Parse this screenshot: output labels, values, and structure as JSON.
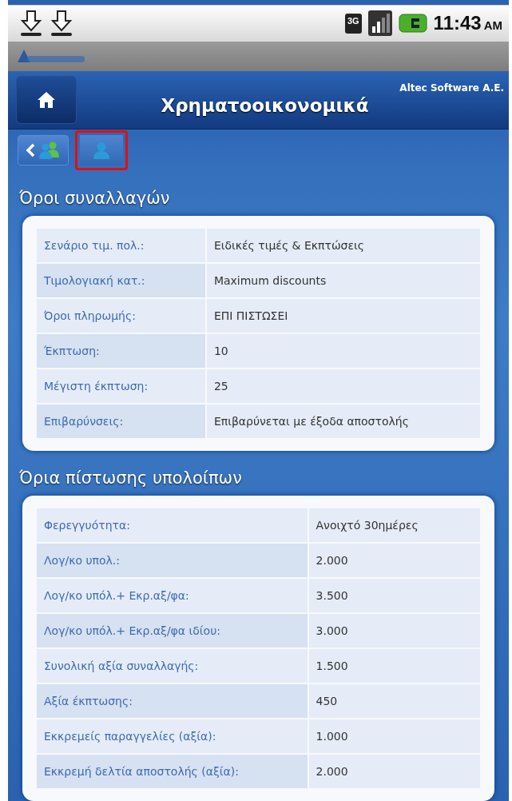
{
  "status_bar": {
    "time": "11:43",
    "ampm": "AM",
    "network": "3G"
  },
  "header": {
    "title": "Χρηματοοικονομικά",
    "company": "Altec Software A.E."
  },
  "toolbar": [
    {
      "kind": "back-group",
      "selected": false
    },
    {
      "kind": "person",
      "selected": true
    }
  ],
  "sections": [
    {
      "title": "Όροι συναλλαγών",
      "rows": [
        {
          "label": "Σενάριο τιμ. πολ.:",
          "value": "Ειδικές τιμές & Εκπτώσεις"
        },
        {
          "label": "Τιμολογιακή κατ.:",
          "value": "Maximum discounts"
        },
        {
          "label": "Όροι πληρωμής:",
          "value": "ΕΠΙ ΠΙΣΤΩΣΕΙ"
        },
        {
          "label": "Έκπτωση:",
          "value": "10"
        },
        {
          "label": "Μέγιστη έκπτωση:",
          "value": "25"
        },
        {
          "label": "Επιβαρύνσεις:",
          "value": "Επιβαρύνεται με έξοδα αποστολής"
        }
      ]
    },
    {
      "title": "Όρια πίστωσης υπολοίπων",
      "rows": [
        {
          "label": "Φερεγγυότητα:",
          "value": "Ανοιχτό 30ημέρες"
        },
        {
          "label": "Λογ/κο υπολ.:",
          "value": "2.000"
        },
        {
          "label": "Λογ/κο υπόλ.+ Εκρ.αξ/φα:",
          "value": "3.500"
        },
        {
          "label": "Λογ/κο υπόλ.+ Εκρ.αξ/φα ιδίου:",
          "value": "3.000"
        },
        {
          "label": "Συνολική αξία συναλλαγής:",
          "value": "1.500"
        },
        {
          "label": "Αξία έκπτωσης:",
          "value": "450"
        },
        {
          "label": "Εκκρεμείς παραγγελίες (αξία):",
          "value": "1.000"
        },
        {
          "label": "Εκκρεμή δελτία αποστολής (αξία):",
          "value": "2.000"
        }
      ]
    }
  ]
}
